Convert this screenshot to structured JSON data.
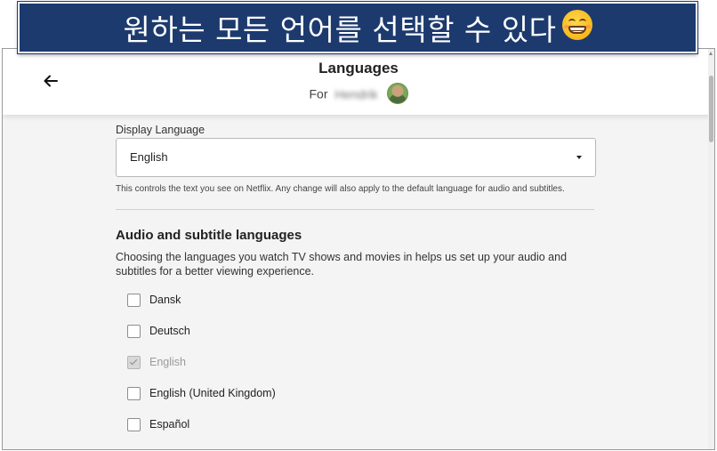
{
  "banner": {
    "text": "원하는 모든 언어를 선택할 수 있다",
    "emoji": "grinning-face-emoji",
    "color": "#1c3a6e"
  },
  "header": {
    "title": "Languages",
    "for_label": "For",
    "profile_name": "Hendrik",
    "back_icon": "arrow-left-icon"
  },
  "display_language": {
    "label": "Display Language",
    "value": "English",
    "helper": "This controls the text you see on Netflix. Any change will also apply to the default language for audio and subtitles."
  },
  "audio_subtitle": {
    "title": "Audio and subtitle languages",
    "description": "Choosing the languages you watch TV shows and movies in helps us set up your audio and subtitles for a better viewing experience.",
    "languages": [
      {
        "label": "Dansk",
        "checked": false,
        "disabled": false
      },
      {
        "label": "Deutsch",
        "checked": false,
        "disabled": false
      },
      {
        "label": "English",
        "checked": true,
        "disabled": true
      },
      {
        "label": "English (United Kingdom)",
        "checked": false,
        "disabled": false
      },
      {
        "label": "Español",
        "checked": false,
        "disabled": false
      }
    ]
  }
}
